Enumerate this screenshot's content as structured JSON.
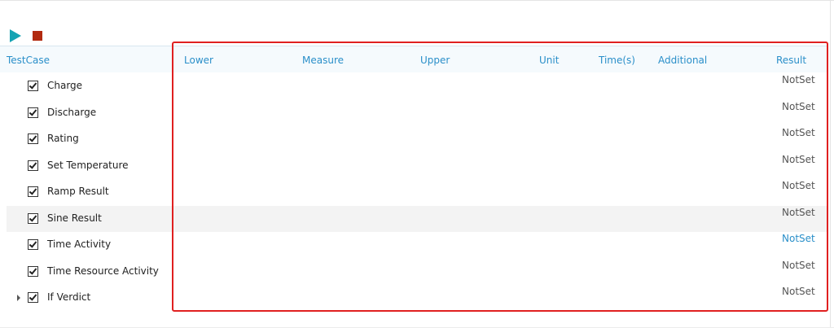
{
  "toolbar": {
    "run_icon": "play-icon",
    "stop_icon": "stop-icon"
  },
  "columns": {
    "testcase": "TestCase",
    "lower": "Lower",
    "measure": "Measure",
    "upper": "Upper",
    "unit": "Unit",
    "time": "Time(s)",
    "additional": "Additional",
    "result": "Result"
  },
  "rows": [
    {
      "label": "Charge",
      "checked": true,
      "result": "NotSet"
    },
    {
      "label": "Discharge",
      "checked": true,
      "result": "NotSet"
    },
    {
      "label": "Rating",
      "checked": true,
      "result": "NotSet"
    },
    {
      "label": "Set Temperature",
      "checked": true,
      "result": "NotSet"
    },
    {
      "label": "Ramp Result",
      "checked": true,
      "result": "NotSet"
    },
    {
      "label": "Sine Result",
      "checked": true,
      "result": "NotSet",
      "selected": true
    },
    {
      "label": "Time Activity",
      "checked": true,
      "result": "NotSet",
      "link": true
    },
    {
      "label": "Time Resource Activity",
      "checked": true,
      "result": "NotSet"
    },
    {
      "label": "If Verdict",
      "checked": true,
      "result": "NotSet",
      "expandable": true
    }
  ],
  "colors": {
    "accent": "#2a8fc9",
    "run": "#16a3b3",
    "stop": "#b22a10",
    "highlight": "#e02020"
  }
}
